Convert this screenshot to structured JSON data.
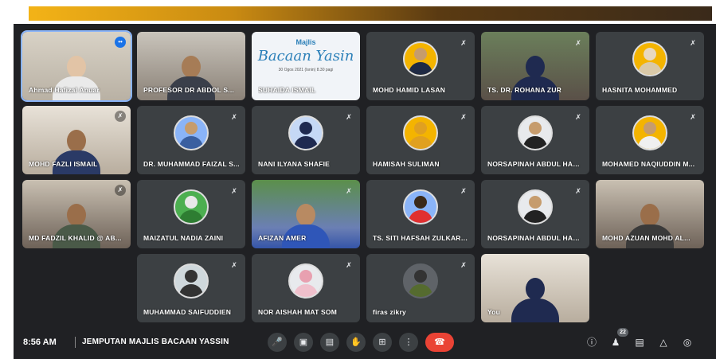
{
  "meeting": {
    "time": "8:56 AM",
    "title": "JEMPUTAN MAJLIS BACAAN YASSIN",
    "participant_count": "22"
  },
  "poster": {
    "line1": "Majlis",
    "line2": "Bacaan Yasin",
    "line3": "30 Ogos 2021 (Isnin) 8.30 pagi"
  },
  "tiles": [
    {
      "name": "Ahmad Hafizal Anuar",
      "mic": "active"
    },
    {
      "name": "PROFESOR DR ABDOL S...",
      "mic": "none"
    },
    {
      "name": "SUHAIDA ISMAIL",
      "mic": "none"
    },
    {
      "name": "MOHD HAMID LASAN",
      "mic": "off"
    },
    {
      "name": "TS. DR. ROHANA ZUR",
      "mic": "off"
    },
    {
      "name": "HASNITA MOHAMMED",
      "mic": "off"
    },
    {
      "name": "MOHD FAZLI ISMAIL",
      "mic": "dim"
    },
    {
      "name": "DR. MUHAMMAD FAIZAL S...",
      "mic": "off"
    },
    {
      "name": "NANI ILYANA SHAFIE",
      "mic": "off"
    },
    {
      "name": "HAMISAH SULIMAN",
      "mic": "off"
    },
    {
      "name": "NORSAPINAH ABDUL HAM...",
      "mic": "off"
    },
    {
      "name": "MOHAMED NAQIUDDIN M...",
      "mic": "off"
    },
    {
      "name": "MD FADZIL KHALID @ AB...",
      "mic": "dim"
    },
    {
      "name": "MAIZATUL NADIA ZAINI",
      "mic": "off"
    },
    {
      "name": "AFIZAN AMER",
      "mic": "off"
    },
    {
      "name": "TS. SITI HAFSAH ZULKARN...",
      "mic": "off"
    },
    {
      "name": "NORSAPINAH ABDUL HAM...",
      "mic": "off"
    },
    {
      "name": "MOHD AZUAN MOHD AL...",
      "mic": "none"
    },
    {
      "name": "MUHAMMAD SAIFUDDIEN",
      "mic": "off"
    },
    {
      "name": "NOR AISHAH MAT SOM",
      "mic": "off"
    },
    {
      "name": "firas zikry",
      "mic": "off"
    },
    {
      "name": "You",
      "mic": "none"
    }
  ],
  "icons": {
    "mic": "microphone-icon",
    "camera": "camera-icon",
    "captions": "captions-icon",
    "hand": "raise-hand-icon",
    "present": "present-screen-icon",
    "more": "more-options-icon",
    "end": "end-call-icon",
    "info": "info-icon",
    "people": "people-icon",
    "chat": "chat-icon",
    "activities": "activities-icon",
    "host": "host-controls-icon"
  },
  "colors": {
    "background": "#202124",
    "tile": "#3c4043",
    "end_call": "#ea4335",
    "active_speaker": "#1a73e8"
  }
}
